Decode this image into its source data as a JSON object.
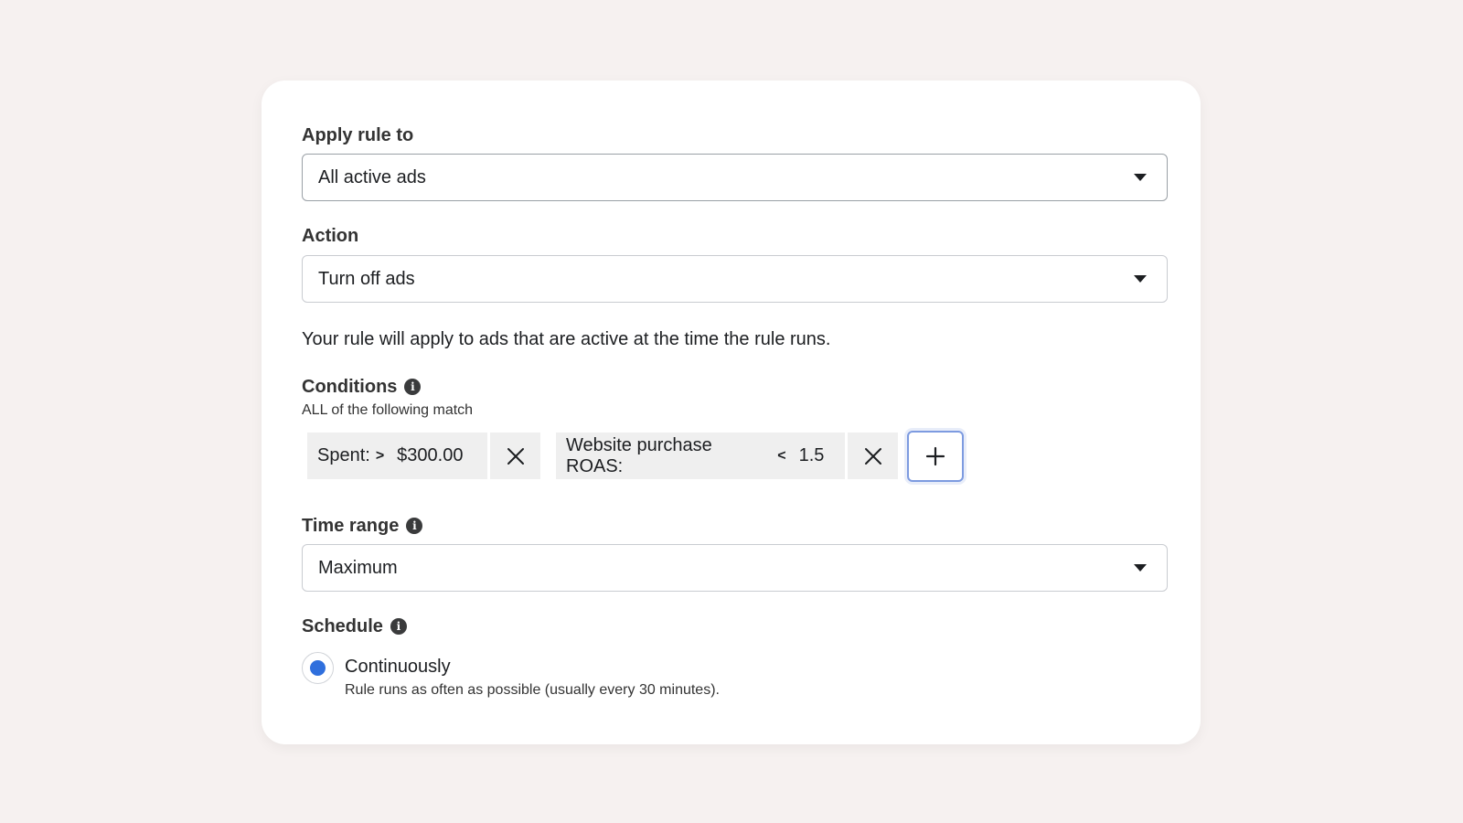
{
  "apply_rule": {
    "label": "Apply rule to",
    "value": "All active ads"
  },
  "action": {
    "label": "Action",
    "value": "Turn off ads"
  },
  "action_note": "Your rule will apply to ads that are active at the time the rule runs.",
  "conditions": {
    "label": "Conditions",
    "match_text": "ALL of the following match",
    "items": [
      {
        "metric": "Spent:",
        "operator": ">",
        "value": "$300.00"
      },
      {
        "metric": "Website purchase ROAS:",
        "operator": "<",
        "value": "1.5"
      }
    ]
  },
  "time_range": {
    "label": "Time range",
    "value": "Maximum"
  },
  "schedule": {
    "label": "Schedule",
    "option_label": "Continuously",
    "option_description": "Rule runs as often as possible (usually every 30 minutes)."
  },
  "colors": {
    "accent": "#2f6fdd",
    "focus_border": "#7d9be0",
    "chip_bg": "#efefef"
  },
  "icons": {
    "info": "info-icon",
    "dropdown": "caret-down-icon",
    "remove": "close-icon",
    "add": "plus-icon"
  }
}
